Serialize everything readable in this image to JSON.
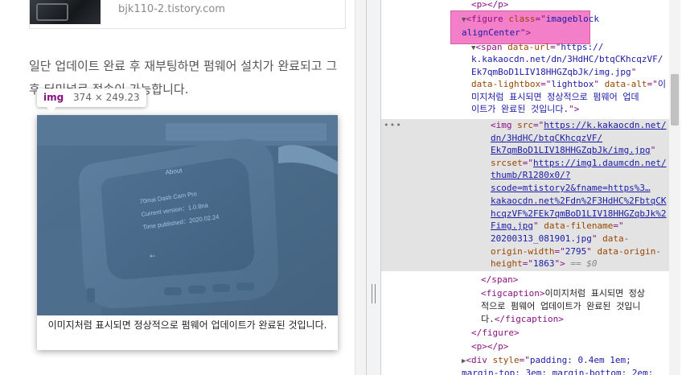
{
  "blog": {
    "link_card": {
      "url": "bjk110-2.tistory.com"
    },
    "paragraph": "일단 업데이트 완료 후 재부팅하면 펌웨어 설치가 완료되고 그 후 터미널로 접속이 가능합니다.",
    "tooltip": {
      "tag": "img",
      "size": "374 × 249.23"
    },
    "photo_screen": {
      "title": "About",
      "line1": "70mai Dash Cam Pro",
      "line2": "Current version：1.0.8na",
      "line3": "Time published：2020.02.24"
    },
    "caption": "이미지처럼 표시되면 정상적으로 펌웨어 업데이트가 완료된 것입니다."
  },
  "devtools": {
    "lines": {
      "l01": "<p></p>",
      "l02_tag": "<figure ",
      "l02_an": "class",
      "l02_eq": "=\"",
      "l02_av": "imageblock",
      "l03_av": "alignCenter",
      "l03_end": "\">",
      "l04_tag": "<span ",
      "l04_an": "data-url",
      "l04_av": "https://",
      "l05_av": "k.kakaocdn.net/dn/3HdHC/btqCKhcqzVF/",
      "l06_av": "Ek7qmBoD1LIV18HHGZqbJk/img.jpg",
      "l07_an": "data-lightbox",
      "l07_av": "lightbox",
      "l07_an2": "data-alt",
      "l07_av2": "이",
      "l08_av": "미지처럼 표시되면 정상적으로 펌웨어 업데",
      "l09_av": "이트가 완료된 것입니다.",
      "l09_end": "\">",
      "l10_tag": "<img ",
      "l10_an": "src",
      "l10_av": "https://k.kakaocdn.net/",
      "l11_av": "dn/3HdHC/btqCKhcqzVF/",
      "l12_av": "Ek7qmBoD1LIV18HHGZqbJk/img.jpg",
      "l13_an": "srcset",
      "l13_av": "https://img1.daumcdn.net/",
      "l14_av": "thumb/R1280x0/?",
      "l15_av": "scode=mtistory2&fname=https%3…",
      "l16_av": "kakaocdn.net%2Fdn%2F3HdHC%2FbtqCK",
      "l17_av": "hcqzVF%2FEk7qmBoD1LIV18HHGZqbJk%2",
      "l18_av": "Fimg.jpg",
      "l18_an": "data-filename",
      "l19_av": "20200313_081901.jpg",
      "l19_an": "data-",
      "l20_an": "origin-width",
      "l20_av": "2795",
      "l20_an2": "data-origin-",
      "l21_an": "height",
      "l21_av": "1863",
      "l21_dim": "== $0",
      "l22": "</span>",
      "l23_tag": "<figcaption>",
      "l23_txt": "이미지처럼 표시되면 정상",
      "l24_txt": "적으로 펌웨어 업데이트가 완료된 것입니",
      "l25_txt": "다.",
      "l25_tag": "</figcaption>",
      "l26": "</figure>",
      "l27": "<p></p>",
      "l28_tag": "<div ",
      "l28_an": "style",
      "l28_av": "padding: 0.4em 1em;",
      "l29_av": "margin-top: 3em; margin-bottom: 2em;"
    },
    "dots": "•••"
  }
}
